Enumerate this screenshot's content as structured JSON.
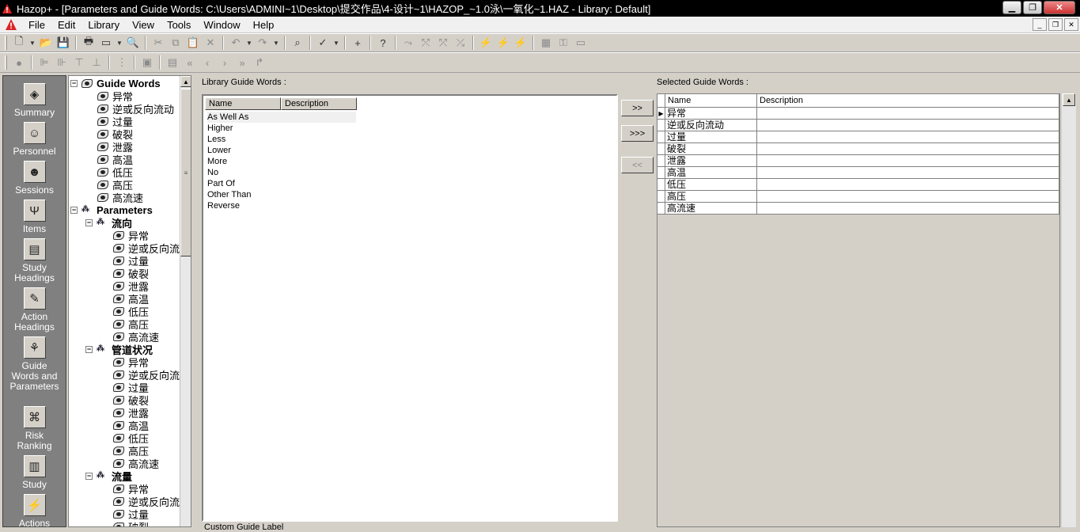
{
  "window": {
    "title": "Hazop+ - [Parameters and Guide Words: C:\\Users\\ADMINI~1\\Desktop\\提交作品\\4-设计~1\\HAZOP_~1.0泳\\一氧化~1.HAZ - Library: Default]"
  },
  "menu": [
    "File",
    "Edit",
    "Library",
    "View",
    "Tools",
    "Window",
    "Help"
  ],
  "sidebar": [
    {
      "label": "Summary",
      "icon": "summary-icon"
    },
    {
      "label": "Personnel",
      "icon": "personnel-icon"
    },
    {
      "label": "Sessions",
      "icon": "sessions-icon"
    },
    {
      "label": "Items",
      "icon": "items-icon"
    },
    {
      "label": "Study\nHeadings",
      "icon": "study-headings-icon"
    },
    {
      "label": "Action\nHeadings",
      "icon": "action-headings-icon"
    },
    {
      "label": "Guide\nWords and\nParameters",
      "icon": "guide-words-icon"
    },
    {
      "label": "Risk\nRanking",
      "icon": "risk-ranking-icon"
    },
    {
      "label": "Study",
      "icon": "study-icon"
    },
    {
      "label": "Actions",
      "icon": "actions-icon"
    }
  ],
  "tree": {
    "guide_words_label": "Guide Words",
    "guide_words": [
      "异常",
      "逆或反向流动",
      "过量",
      "破裂",
      "泄露",
      "高温",
      "低压",
      "高压",
      "高流速"
    ],
    "parameters_label": "Parameters",
    "groups": [
      {
        "name": "流向",
        "items": [
          "异常",
          "逆或反向流",
          "过量",
          "破裂",
          "泄露",
          "高温",
          "低压",
          "高压",
          "高流速"
        ]
      },
      {
        "name": "管道状况",
        "items": [
          "异常",
          "逆或反向流",
          "过量",
          "破裂",
          "泄露",
          "高温",
          "低压",
          "高压",
          "高流速"
        ]
      },
      {
        "name": "流量",
        "items": [
          "异常",
          "逆或反向流",
          "过量",
          "破裂"
        ]
      }
    ]
  },
  "library": {
    "label": "Library Guide Words :",
    "columns": [
      "Name",
      "Description"
    ],
    "rows": [
      "As Well As",
      "Higher",
      "Less",
      "Lower",
      "More",
      "No",
      "Part Of",
      "Other Than",
      "Reverse"
    ]
  },
  "buttons": {
    "add": ">>",
    "add_all": ">>>",
    "remove": "<<"
  },
  "selected": {
    "label": "Selected Guide Words :",
    "columns": [
      "Name",
      "Description"
    ],
    "rows": [
      "异常",
      "逆或反向流动",
      "过量",
      "破裂",
      "泄露",
      "高温",
      "低压",
      "高压",
      "高流速"
    ]
  },
  "bottom_label": "Custom Guide Label"
}
